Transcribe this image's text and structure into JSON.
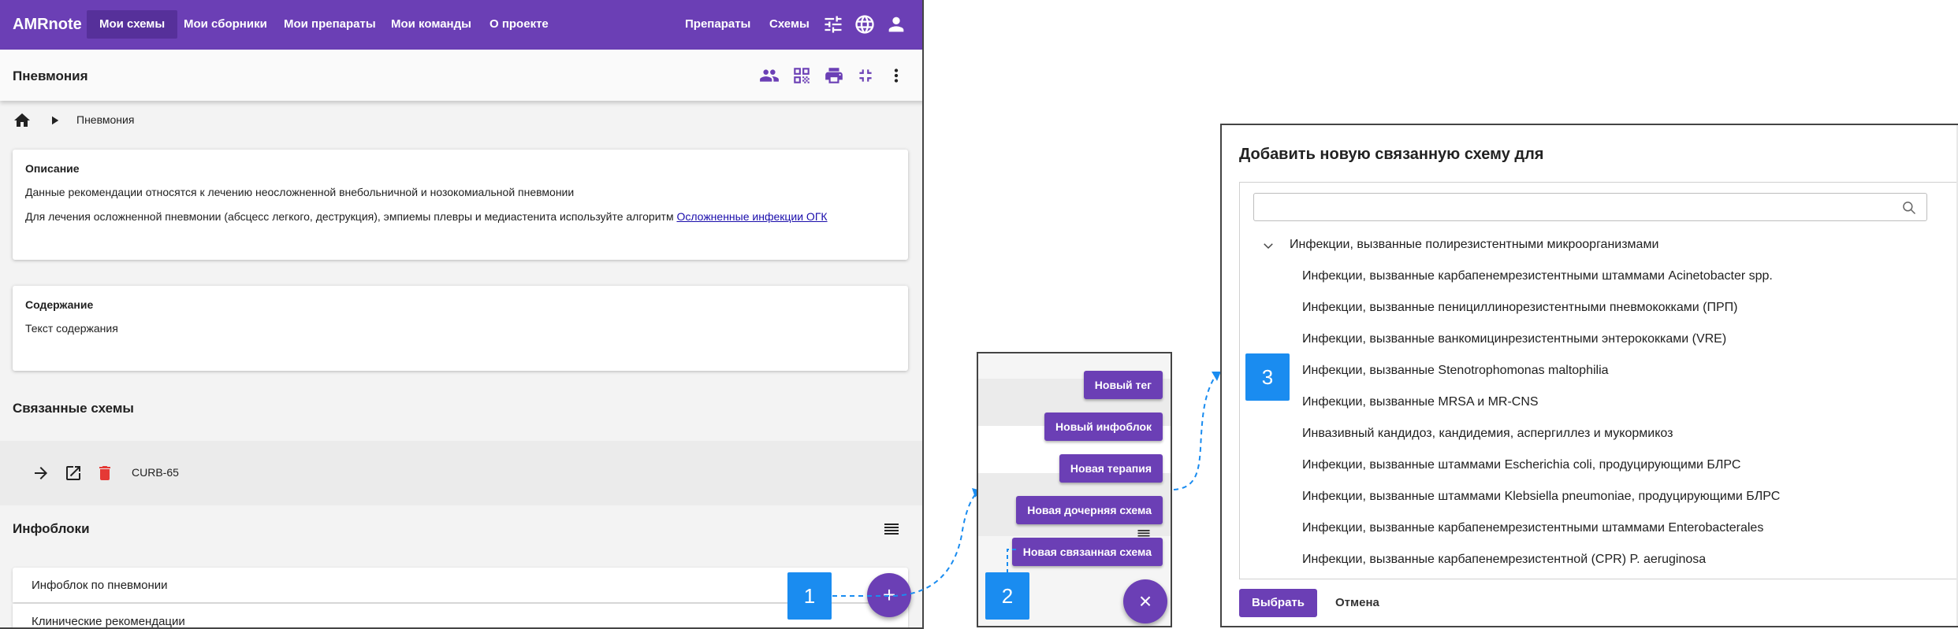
{
  "app": {
    "logo": "AMRnote",
    "nav": [
      "Мои схемы",
      "Мои сборники",
      "Мои препараты",
      "Мои команды",
      "О проекте"
    ],
    "nav_right": [
      "Препараты",
      "Схемы"
    ],
    "accent_color": "#6b3fb5",
    "icons": [
      "tune-icon",
      "globe-icon",
      "account-icon"
    ]
  },
  "subbar": {
    "title": "Пневмония",
    "icons": [
      "people-icon",
      "qr-code-icon",
      "print-icon",
      "collapse-icon",
      "more-vert-icon"
    ]
  },
  "breadcrumb": {
    "current": "Пневмония"
  },
  "description_card": {
    "heading": "Описание",
    "line1": "Данные рекомендации относятся к лечению неосложненной внебольничной и нозокомиальной пневмонии",
    "line2": "Для лечения осложненной пневмонии (абсцесс легкого, деструкция), эмпиемы плевры и медиастенита используйте алгоритм",
    "line2_link": "Осложненные инфекции ОГК"
  },
  "content_card": {
    "heading": "Содержание",
    "text": "Текст содержания"
  },
  "related": {
    "title": "Связанные схемы",
    "item_label": "CURB-65"
  },
  "infoblocks": {
    "title": "Инфоблоки",
    "items": [
      "Инфоблок по пневмонии",
      "Клинические рекомендации"
    ]
  },
  "fab": {
    "open_symbol": "+",
    "close_symbol": "×"
  },
  "steps": {
    "one": "1",
    "two": "2",
    "three": "3"
  },
  "speed_dial": {
    "items": [
      "Новый тег",
      "Новый инфоблок",
      "Новая терапия",
      "Новая дочерняя схема",
      "Новая связанная схема"
    ]
  },
  "dialog": {
    "title": "Добавить новую связанную схему для",
    "search_placeholder": "",
    "parent": "Инфекции, вызванные полирезистентными микроорганизмами",
    "items": [
      "Инфекции, вызванные карбапенемрезистентными штаммами Acinetobacter spp.",
      "Инфекции, вызванные пенициллинорезистентными пневмококками (ПРП)",
      "Инфекции, вызванные ванкомицинрезистентными энтерококками (VRE)",
      "Инфекции, вызванные Stenotrophomonas maltophilia",
      "Инфекции, вызванные MRSA и MR-CNS",
      "Инвазивный кандидоз, кандидемия, аспергиллез и мукормикоз",
      "Инфекции, вызванные штаммами Escherichia coli, продуцирующими БЛРС",
      "Инфекции, вызванные штаммами Klebsiella pneumoniae, продуцирующими БЛРС",
      "Инфекции, вызванные карбапенемрезистентными штаммами Enterobacterales",
      "Инфекции, вызванные карбапенемрезистентной (CPR) P. aeruginosa"
    ],
    "ok_label": "Выбрать",
    "cancel_label": "Отмена"
  }
}
